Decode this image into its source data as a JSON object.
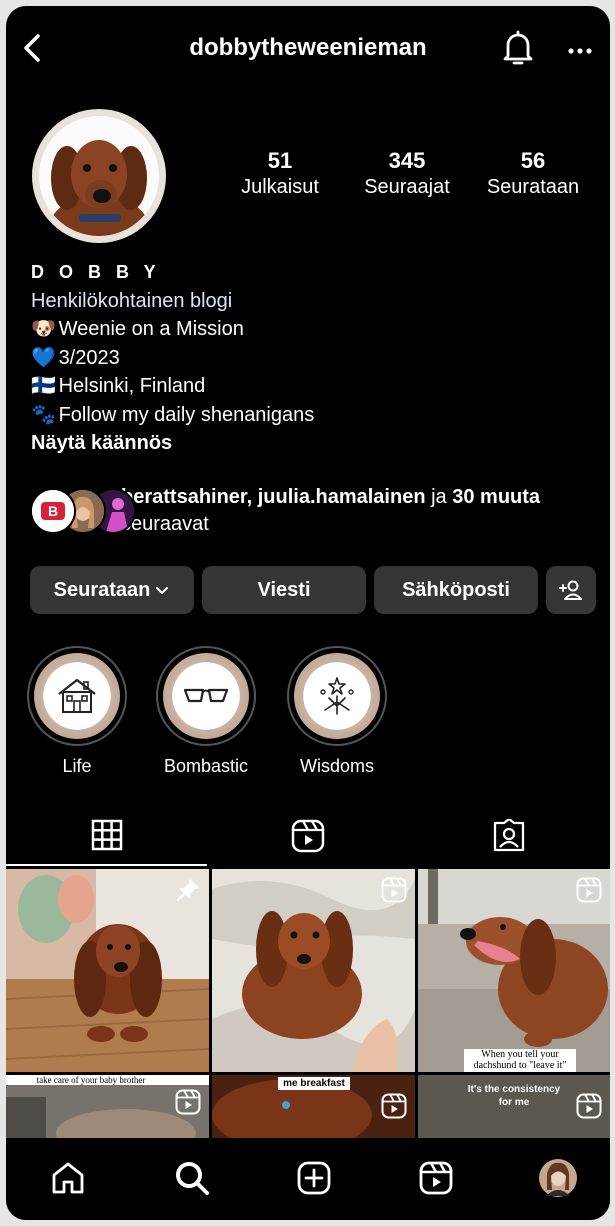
{
  "header": {
    "username": "dobbytheweenieman"
  },
  "stats": [
    {
      "value": "51",
      "label": "Julkaisut"
    },
    {
      "value": "345",
      "label": "Seuraajat"
    },
    {
      "value": "56",
      "label": "Seurataan"
    }
  ],
  "bio": {
    "name": "D O B B Y",
    "category": "Henkilökohtainen blogi",
    "lines": [
      {
        "emoji": "🐶",
        "text": "Weenie on a Mission"
      },
      {
        "emoji": "💙",
        "text": "3/2023"
      },
      {
        "emoji": "🇫🇮",
        "text": "Helsinki, Finland"
      },
      {
        "emoji": "🐾",
        "text": "Follow my daily shenanigans"
      }
    ],
    "translate": "Näytä käännös"
  },
  "followed_by": {
    "names": "berattsahiner, juulia.hamalainen",
    "connector": "ja",
    "count_text": "30 muuta",
    "suffix": "seuraavat"
  },
  "actions": {
    "following": "Seurataan",
    "message": "Viesti",
    "email": "Sähköposti"
  },
  "highlights": [
    {
      "label": "Life",
      "icon": "house-icon"
    },
    {
      "label": "Bombastic",
      "icon": "sunglasses-icon"
    },
    {
      "label": "Wisdoms",
      "icon": "fireworks-icon"
    }
  ],
  "posts": {
    "captions": {
      "p3": "When you tell your dachshund to \"leave it\"",
      "p4": "take care of your baby brother",
      "p5": "me breakfast",
      "p6": "It's the consistency for me"
    }
  },
  "colors": {
    "background": "#000000",
    "button": "#363636",
    "category": "#d8e7f7"
  }
}
